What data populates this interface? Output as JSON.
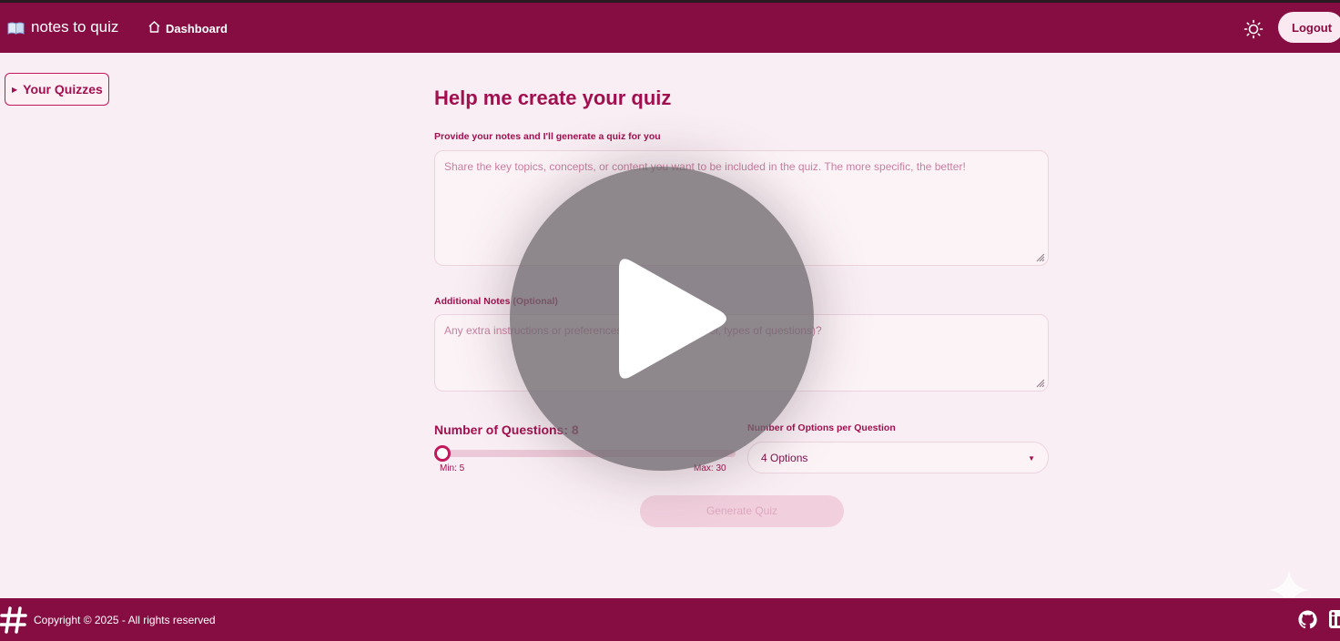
{
  "header": {
    "brand": "notes to quiz",
    "brand_icon": "book-icon",
    "nav_dashboard": "Dashboard",
    "theme_icon": "sun-icon",
    "logout_label": "Logout"
  },
  "sidebar": {
    "your_quizzes": "Your Quizzes"
  },
  "main": {
    "title": "Help me create your quiz",
    "notes_label": "Provide your notes and I'll generate a quiz for you",
    "notes_placeholder": "Share the key topics, concepts, or content you want to be included in the quiz. The more specific, the better!",
    "additional_label": "Additional Notes (Optional)",
    "additional_placeholder": "Any extra instructions or preferences (e.g., difficulty level, types of questions)?",
    "num_questions_label": "Number of Questions: 8",
    "num_questions_value": 8,
    "slider_min_label": "Min: 5",
    "slider_max_label": "Max: 30",
    "slider_min": 5,
    "slider_max": 30,
    "options_label": "Number of Options per Question",
    "options_selected": "4 Options",
    "generate_label": "Generate Quiz"
  },
  "overlay": {
    "icon": "play-icon"
  },
  "footer": {
    "copyright": "Copyright © 2025 - All rights reserved",
    "logo_icon": "hash-logo-icon",
    "links": [
      "github-icon",
      "linkedin-icon"
    ]
  },
  "colors": {
    "primary": "#850d41",
    "accent": "#c2185b",
    "background": "#f9eef4"
  }
}
